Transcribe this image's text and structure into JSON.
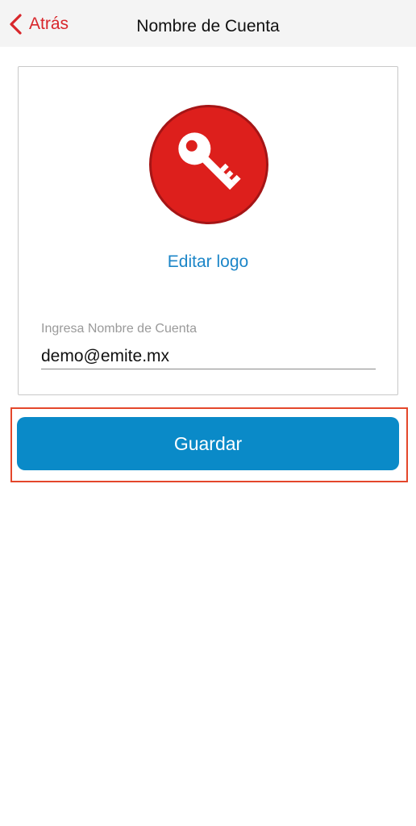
{
  "navbar": {
    "back_label": "Atrás",
    "title": "Nombre de Cuenta"
  },
  "card": {
    "logo_icon": "key-icon",
    "edit_logo_label": "Editar logo",
    "field_label": "Ingresa Nombre de Cuenta",
    "field_value": "demo@emite.mx"
  },
  "actions": {
    "save_label": "Guardar"
  },
  "colors": {
    "accent_red": "#d8262b",
    "logo_red": "#dd1f1c",
    "link_blue": "#1c86c8",
    "button_blue": "#0a8ac8",
    "highlight_frame": "#e4472b"
  }
}
